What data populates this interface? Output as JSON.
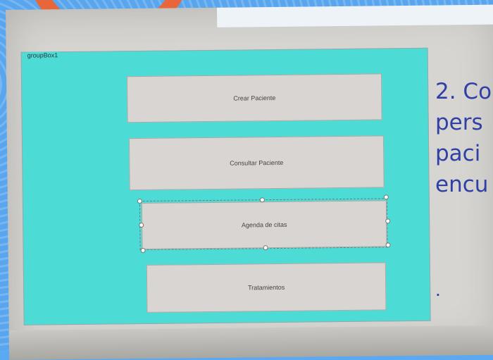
{
  "groupbox": {
    "caption": "groupBox1"
  },
  "buttons": [
    {
      "label": "Crear Paciente"
    },
    {
      "label": "Consultar Paciente"
    },
    {
      "label": "Agenda de citas",
      "selected": true
    },
    {
      "label": "Tratamientos"
    }
  ],
  "overlay": {
    "lines": "2. Co\npers\npaci\nencu",
    "dot": "."
  },
  "colors": {
    "groupbox_bg": "#4ddbd6",
    "button_bg": "#d8d5d2",
    "overlay_text": "#2f3fa6",
    "accent_orange": "#e8663a",
    "outer_bg": "#5aa6ee"
  }
}
